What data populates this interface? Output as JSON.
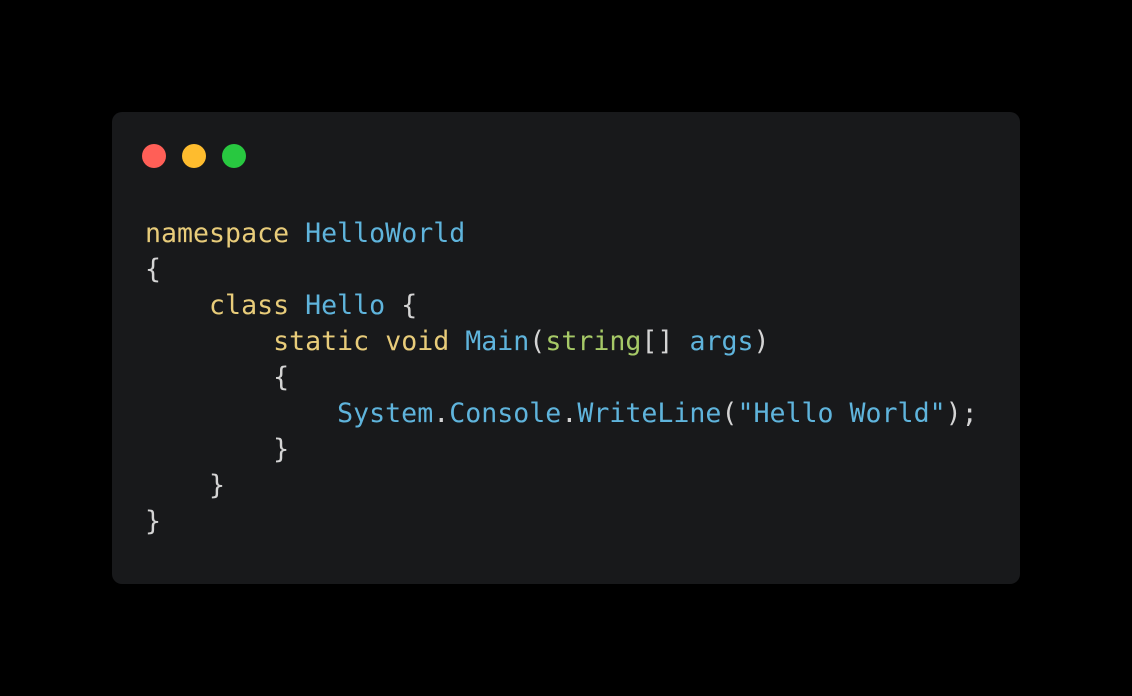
{
  "window": {
    "controls": [
      {
        "name": "close",
        "color": "#ff5f57"
      },
      {
        "name": "minimize",
        "color": "#febc2e"
      },
      {
        "name": "maximize",
        "color": "#28c840"
      }
    ]
  },
  "colors": {
    "background": "#000000",
    "window": "#18191b",
    "keyword": "#e8cc7a",
    "identifier": "#5fb4dc",
    "type": "#a6c967",
    "punctuation": "#d4d4d4"
  },
  "code": {
    "lines": [
      [
        {
          "text": "namespace",
          "kind": "keyword"
        },
        {
          "text": " ",
          "kind": "punctuation"
        },
        {
          "text": "HelloWorld",
          "kind": "identifier"
        }
      ],
      [
        {
          "text": "{",
          "kind": "punctuation"
        }
      ],
      [
        {
          "text": "    ",
          "kind": "punctuation"
        },
        {
          "text": "class",
          "kind": "keyword"
        },
        {
          "text": " ",
          "kind": "punctuation"
        },
        {
          "text": "Hello",
          "kind": "identifier"
        },
        {
          "text": " {",
          "kind": "punctuation"
        }
      ],
      [
        {
          "text": "        ",
          "kind": "punctuation"
        },
        {
          "text": "static",
          "kind": "keyword"
        },
        {
          "text": " ",
          "kind": "punctuation"
        },
        {
          "text": "void",
          "kind": "keyword"
        },
        {
          "text": " ",
          "kind": "punctuation"
        },
        {
          "text": "Main",
          "kind": "identifier"
        },
        {
          "text": "(",
          "kind": "punctuation"
        },
        {
          "text": "string",
          "kind": "type"
        },
        {
          "text": "[] ",
          "kind": "punctuation"
        },
        {
          "text": "args",
          "kind": "identifier"
        },
        {
          "text": ")",
          "kind": "punctuation"
        }
      ],
      [
        {
          "text": "        {",
          "kind": "punctuation"
        }
      ],
      [
        {
          "text": "            ",
          "kind": "punctuation"
        },
        {
          "text": "System",
          "kind": "identifier"
        },
        {
          "text": ".",
          "kind": "punctuation"
        },
        {
          "text": "Console",
          "kind": "identifier"
        },
        {
          "text": ".",
          "kind": "punctuation"
        },
        {
          "text": "WriteLine",
          "kind": "identifier"
        },
        {
          "text": "(",
          "kind": "punctuation"
        },
        {
          "text": "\"Hello World\"",
          "kind": "identifier"
        },
        {
          "text": ");",
          "kind": "punctuation"
        }
      ],
      [
        {
          "text": "        }",
          "kind": "punctuation"
        }
      ],
      [
        {
          "text": "    }",
          "kind": "punctuation"
        }
      ],
      [
        {
          "text": "}",
          "kind": "punctuation"
        }
      ]
    ]
  }
}
